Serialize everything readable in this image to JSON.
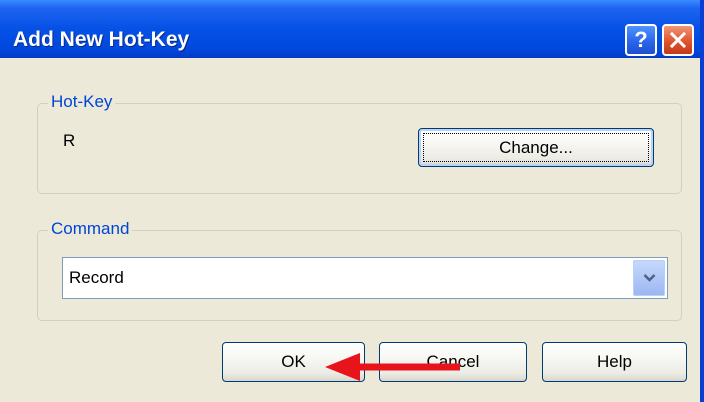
{
  "window": {
    "title": "Add New Hot-Key",
    "help_button": "?"
  },
  "hotkey_group": {
    "legend": "Hot-Key",
    "value": "R",
    "change_button": "Change..."
  },
  "command_group": {
    "legend": "Command",
    "selected": "Record"
  },
  "footer": {
    "ok_label": "OK",
    "cancel_label": "Cancel",
    "help_label": "Help"
  },
  "colors": {
    "titlebar": "#0551e6",
    "dialog_bg": "#ece9d8",
    "legend_text": "#0046d5",
    "annotation_arrow": "#e8141c"
  },
  "icons": {
    "close": "close-icon",
    "dropdown": "chevron-down-icon",
    "annotation": "arrow-left-icon"
  }
}
